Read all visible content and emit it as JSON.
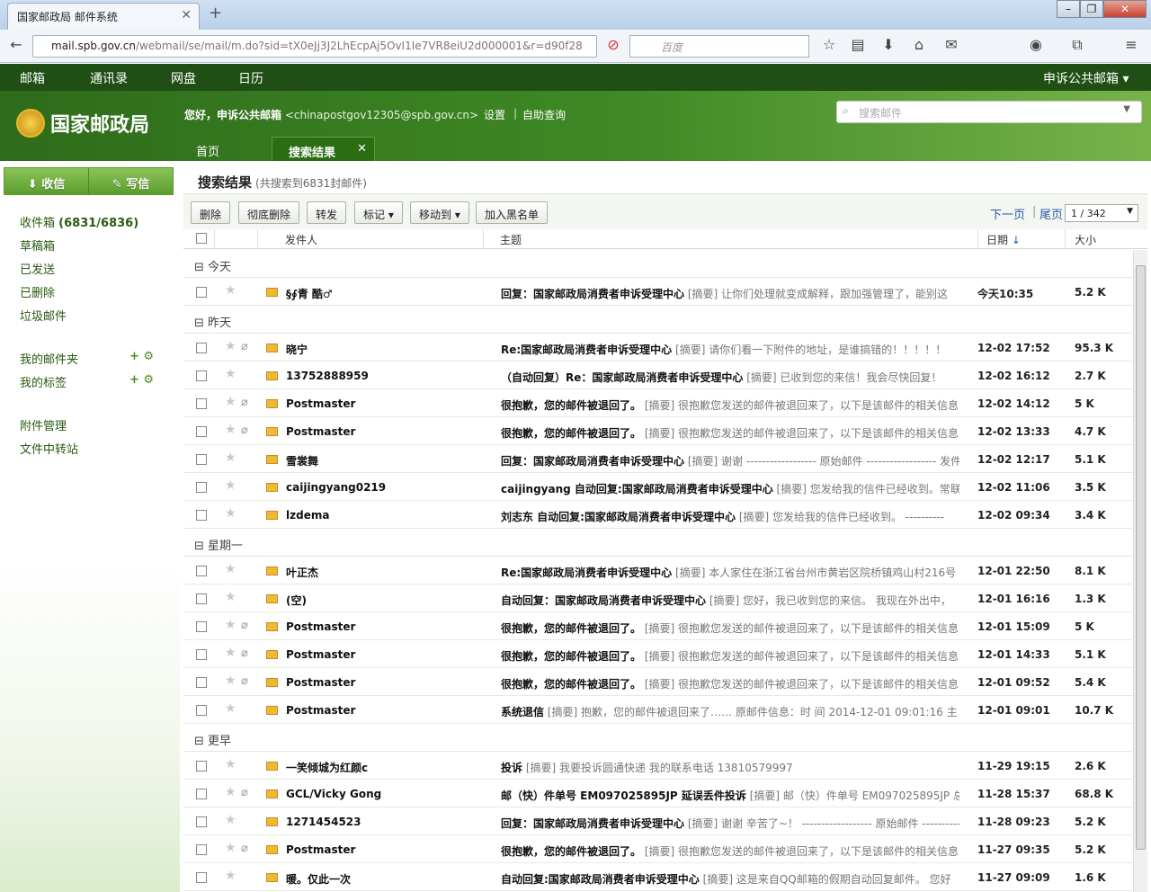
{
  "browser": {
    "tab_title": "国家邮政局 邮件系统",
    "url_host": "mail.spb.gov.cn",
    "url_path": "/webmail/se/mail/m.do?sid=tX0eJj3J2LhEcpAj5OvI1Ie7VR8eiU2d000001&r=d90f28",
    "search_placeholder": "百度"
  },
  "topnav": {
    "mail": "邮箱",
    "contacts": "通讯录",
    "disk": "网盘",
    "calendar": "日历",
    "account": "申诉公共邮箱 ▾"
  },
  "header": {
    "logo": "国家邮政局",
    "greeting": "您好，申诉公共邮箱",
    "address": "<chinapostgov12305@spb.gov.cn>",
    "settings": "设置",
    "selfquery": "自助查询",
    "search_placeholder": "搜索邮件",
    "tab_home": "首页",
    "tab_search": "搜索结果"
  },
  "sidebar": {
    "receive": "收信",
    "compose": "写信",
    "inbox": "收件箱",
    "inbox_count": "(6831/6836)",
    "drafts": "草稿箱",
    "sent": "已发送",
    "deleted": "已删除",
    "spam": "垃圾邮件",
    "my_folders": "我的邮件夹",
    "my_tags": "我的标签",
    "attachments": "附件管理",
    "filetransfer": "文件中转站"
  },
  "main": {
    "title": "搜索结果",
    "count_note": "(共搜索到6831封邮件)",
    "btn_delete": "删除",
    "btn_purge": "彻底删除",
    "btn_forward": "转发",
    "btn_mark": "标记 ▾",
    "btn_move": "移动到 ▾",
    "btn_blacklist": "加入黑名单",
    "next_page": "下一页",
    "last_page": "尾页",
    "page_indicator": "1 / 342",
    "col_sender": "发件人",
    "col_subject": "主题",
    "col_date": "日期",
    "col_size": "大小"
  },
  "groups": {
    "g0": "⊟ 今天",
    "g1": "⊟ 昨天",
    "g2": "⊟ 星期一",
    "g3": "⊟ 更早"
  },
  "rows": [
    {
      "s": "§∮青 酷♂",
      "t": "回复：国家邮政局消费者申诉受理中心",
      "a": "[摘要] 让你们处理就变成解释，跟加强管理了，能别这",
      "d": "今天10:35",
      "z": "5.2 K",
      "c": false
    },
    {
      "s": "晓宁",
      "t": "Re:国家邮政局消费者申诉受理中心",
      "a": "[摘要] 请你们看一下附件的地址，是谁搞错的！！！！！",
      "d": "12-02 17:52",
      "z": "95.3 K",
      "c": true
    },
    {
      "s": "13752888959",
      "t": "（自动回复）Re：国家邮政局消费者申诉受理中心",
      "a": "[摘要] 已收到您的来信！我会尽快回复！",
      "d": "12-02 16:12",
      "z": "2.7 K",
      "c": false
    },
    {
      "s": "Postmaster",
      "t": "很抱歉，您的邮件被退回了。",
      "a": "[摘要] 很抱歉您发送的邮件被退回来了，以下是该邮件的相关信息",
      "d": "12-02 14:12",
      "z": "5 K",
      "c": true
    },
    {
      "s": "Postmaster",
      "t": "很抱歉，您的邮件被退回了。",
      "a": "[摘要] 很抱歉您发送的邮件被退回来了，以下是该邮件的相关信息",
      "d": "12-02 13:33",
      "z": "4.7 K",
      "c": true
    },
    {
      "s": "雪裳舞",
      "t": "回复：国家邮政局消费者申诉受理中心",
      "a": "[摘要] 谢谢 ------------------ 原始邮件 ------------------ 发件",
      "d": "12-02 12:17",
      "z": "5.1 K",
      "c": false
    },
    {
      "s": "caijingyang0219",
      "t": "caijingyang 自动回复:国家邮政局消费者申诉受理中心",
      "a": "[摘要] 您发给我的信件已经收到。常联",
      "d": "12-02 11:06",
      "z": "3.5 K",
      "c": false
    },
    {
      "s": "lzdema",
      "t": "刘志东 自动回复:国家邮政局消费者申诉受理中心",
      "a": "[摘要] 您发给我的信件已经收到。 ----------",
      "d": "12-02 09:34",
      "z": "3.4 K",
      "c": false
    },
    {
      "s": "叶正杰",
      "t": "Re:国家邮政局消费者申诉受理中心",
      "a": "[摘要] 本人家住在浙江省台州市黄岩区院桥镇鸡山村216号",
      "d": "12-01 22:50",
      "z": "8.1 K",
      "c": false
    },
    {
      "s": "(空)",
      "t": "自动回复：国家邮政局消费者申诉受理中心",
      "a": "[摘要] 您好，我已收到您的来信。 我现在外出中，",
      "d": "12-01 16:16",
      "z": "1.3 K",
      "c": false
    },
    {
      "s": "Postmaster",
      "t": "很抱歉，您的邮件被退回了。",
      "a": "[摘要] 很抱歉您发送的邮件被退回来了，以下是该邮件的相关信息",
      "d": "12-01 15:09",
      "z": "5 K",
      "c": true
    },
    {
      "s": "Postmaster",
      "t": "很抱歉，您的邮件被退回了。",
      "a": "[摘要] 很抱歉您发送的邮件被退回来了，以下是该邮件的相关信息",
      "d": "12-01 14:33",
      "z": "5.1 K",
      "c": true
    },
    {
      "s": "Postmaster",
      "t": "很抱歉，您的邮件被退回了。",
      "a": "[摘要] 很抱歉您发送的邮件被退回来了，以下是该邮件的相关信息",
      "d": "12-01 09:52",
      "z": "5.4 K",
      "c": true
    },
    {
      "s": "Postmaster",
      "t": "系统退信",
      "a": "[摘要] 抱歉，您的邮件被退回来了…… 原邮件信息：时 间 2014-12-01 09:01:16 主 题",
      "d": "12-01 09:01",
      "z": "10.7 K",
      "c": false
    },
    {
      "s": "一笑倾城为红颜c",
      "t": "投诉",
      "a": "[摘要] 我要投诉圆通快递 我的联系电话 13810579997",
      "d": "11-29 19:15",
      "z": "2.6 K",
      "c": false
    },
    {
      "s": "GCL/Vicky Gong",
      "t": "邮（快）件单号 EM097025895JP 延误丢件投诉",
      "a": "[摘要] 邮（快）件单号 EM097025895JP 总包",
      "d": "11-28 15:37",
      "z": "68.8 K",
      "c": true
    },
    {
      "s": "1271454523",
      "t": "回复：国家邮政局消费者申诉受理中心",
      "a": "[摘要] 谢谢 辛苦了~！ ------------------ 原始邮件 ----------",
      "d": "11-28 09:23",
      "z": "5.2 K",
      "c": false
    },
    {
      "s": "Postmaster",
      "t": "很抱歉，您的邮件被退回了。",
      "a": "[摘要] 很抱歉您发送的邮件被退回来了，以下是该邮件的相关信息",
      "d": "11-27 09:35",
      "z": "5.2 K",
      "c": true
    },
    {
      "s": "暖。仅此一次",
      "t": "自动回复:国家邮政局消费者申诉受理中心",
      "a": "[摘要] 这是来自QQ邮箱的假期自动回复邮件。 您好",
      "d": "11-27 09:09",
      "z": "1.6 K",
      "c": false
    }
  ]
}
